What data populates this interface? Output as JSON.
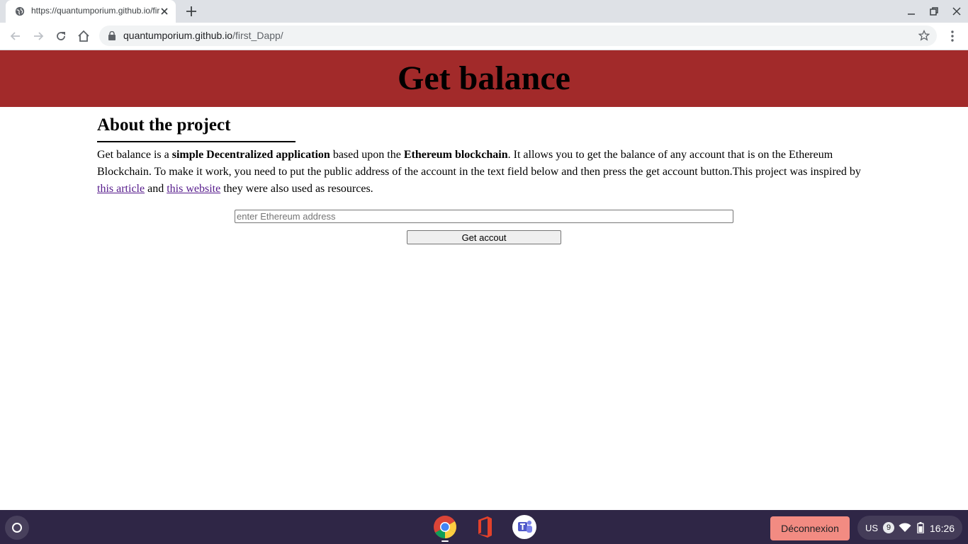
{
  "browser": {
    "tab_title": "https://quantumporium.github.io/first_Dapp/",
    "url_host": "quantumporium.github.io",
    "url_path": "/first_Dapp/"
  },
  "page": {
    "banner_title": "Get balance",
    "section_title": "About the project",
    "paragraph": {
      "p1": "Get balance is a ",
      "b1": "simple Decentralized application",
      "p2": " based upon the ",
      "b2": "Ethereum blockchain",
      "p3": ". It allows you to get the balance of any account that is on the Ethereum Blockchain. To make it work, you need to put the public address of the account in the text field below and then press the get account button.This project was inspired by ",
      "link1": "this article",
      "p4": " and ",
      "link2": "this website",
      "p5": " they were also used as resources."
    },
    "address_input": {
      "placeholder": "enter Ethereum address",
      "value": ""
    },
    "get_button_label": "Get accout"
  },
  "taskbar": {
    "apps": [
      "chrome-icon",
      "office-icon",
      "teams-icon"
    ],
    "logout_label": "Déconnexion",
    "keyboard_layout": "US",
    "notification_count": "9",
    "time": "16:26"
  },
  "colors": {
    "banner": "#a22a2a",
    "link": "#551a8b",
    "taskbar": "#2f2646",
    "logout": "#f28b82"
  }
}
